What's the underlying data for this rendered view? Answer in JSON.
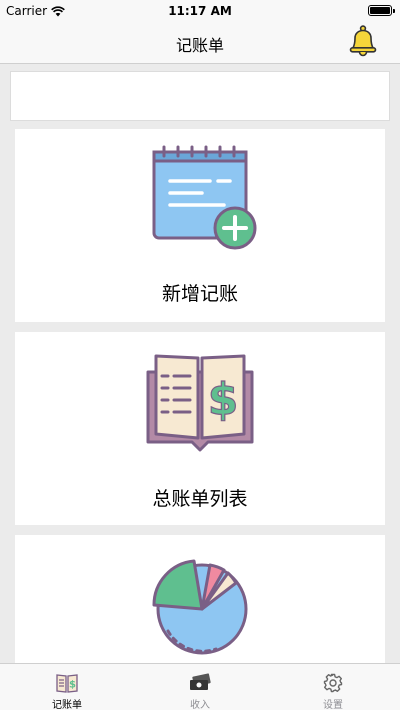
{
  "status_bar": {
    "carrier": "Carrier",
    "time": "11:17 AM"
  },
  "nav": {
    "title": "记账单",
    "bell_icon": "bell-icon"
  },
  "search": {
    "value": ""
  },
  "cards": [
    {
      "label": "新增记账",
      "icon": "notepad-add-icon"
    },
    {
      "label": "总账单列表",
      "icon": "ledger-book-icon"
    },
    {
      "label": "",
      "icon": "pie-chart-icon"
    }
  ],
  "tabs": [
    {
      "label": "记账单",
      "icon": "ledger-tab-icon",
      "active": true
    },
    {
      "label": "收入",
      "icon": "cash-icon",
      "active": false
    },
    {
      "label": "设置",
      "icon": "gear-icon",
      "active": false
    }
  ],
  "colors": {
    "bell": "#f5d63a",
    "notepad": "#8ec6f2",
    "plus_badge": "#5fbf8f",
    "ledger_page": "#f7e9d2",
    "ledger_cover": "#b38aa6",
    "dollar": "#5fbf8f"
  }
}
